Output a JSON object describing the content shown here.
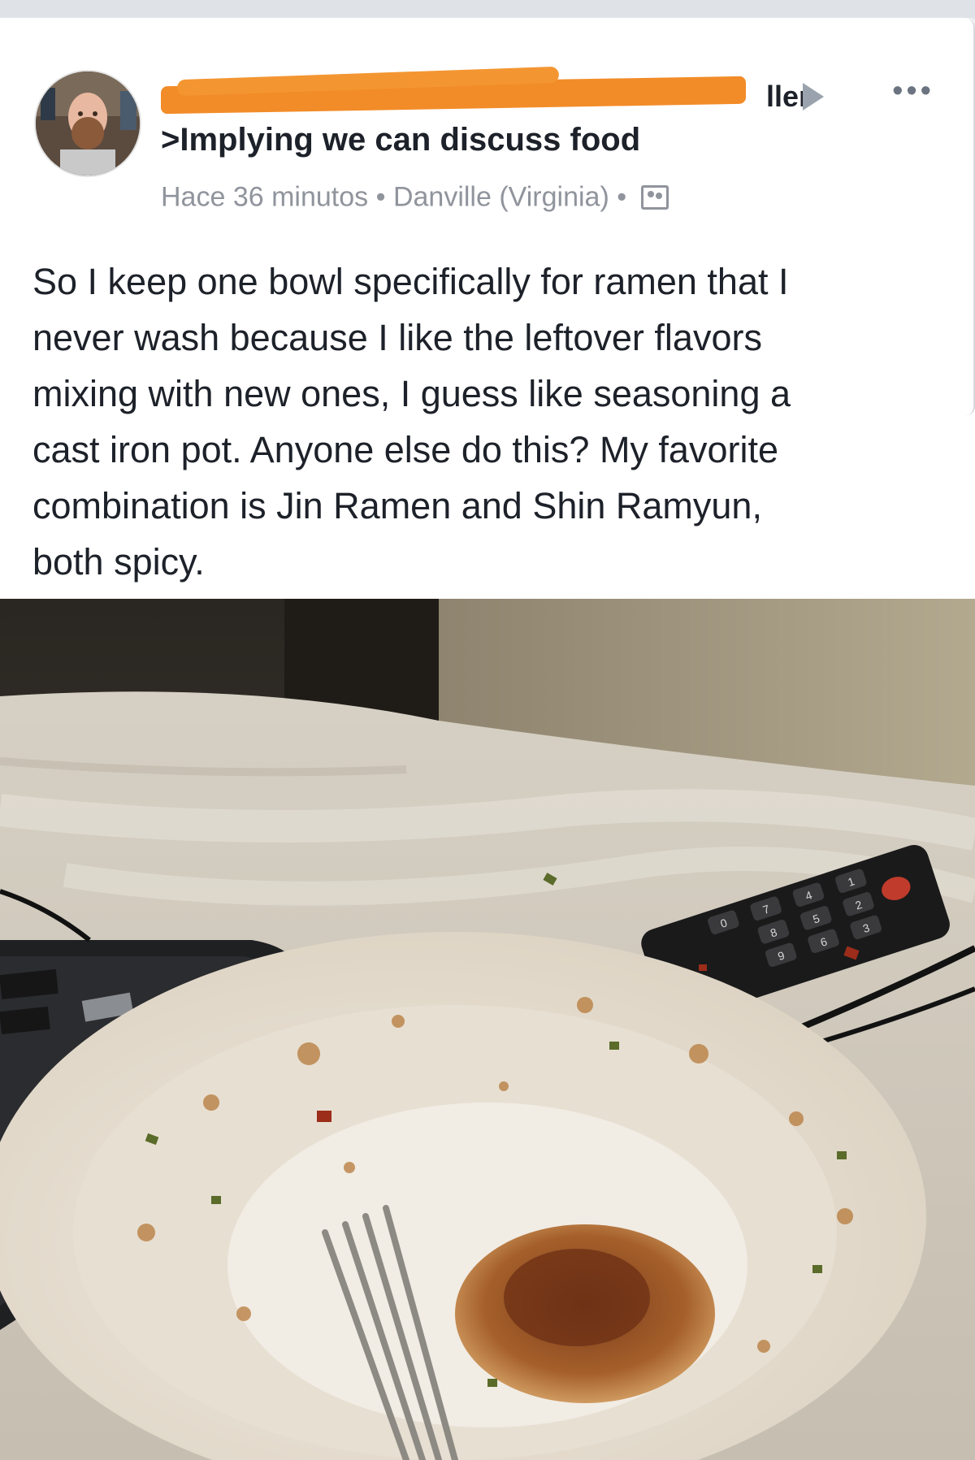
{
  "post": {
    "author_suffix": "ller",
    "group_name": ">Implying we can discuss food",
    "time": "Hace 36 minutos",
    "separator": "•",
    "location": "Danville (Virginia)",
    "text": "So I keep one bowl specifically for ramen that I\nnever wash because I like the leftover flavors\nmixing with new ones, I guess like seasoning a\ncast iron pot. Anyone else do this? My favorite\ncombination is Jin Ramen and Shin Ramyun,\nboth spicy."
  },
  "icons": {
    "more": "more-options-icon",
    "arrow": "group-arrow-icon",
    "audience": "audience-group-icon"
  },
  "remote_keys": [
    "1",
    "2",
    "3",
    "4",
    "5",
    "6",
    "7",
    "8",
    "9",
    "0"
  ]
}
